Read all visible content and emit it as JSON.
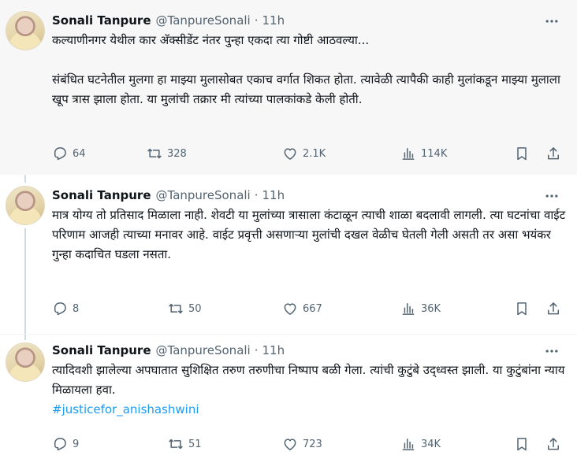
{
  "tweets": [
    {
      "author": {
        "name": "Sonali Tanpure",
        "handle": "@TanpureSonali",
        "time": "11h",
        "avatar": "avatar-photo"
      },
      "paragraphs": [
        "कल्याणीनगर येथील कार अ‍ॅक्सीडेंट नंतर पुन्हा एकदा त्या गोष्टी आठवल्या...",
        "संबंधित घटनेतील मुलगा हा माझ्या मुलासोबत एकाच वर्गात शिकत होता. त्यावेळी त्यापैकी काही मुलांकडून माझ्या मुलाला खूप त्रास झाला होता. या मुलांची तक्रार मी त्यांच्या पालकांकडे केली होती."
      ],
      "stats": {
        "replies": "64",
        "reposts": "328",
        "likes": "2.1K",
        "views": "114K"
      }
    },
    {
      "author": {
        "name": "Sonali Tanpure",
        "handle": "@TanpureSonali",
        "time": "11h",
        "avatar": "avatar-photo"
      },
      "paragraphs": [
        "मात्र योग्य तो प्रतिसाद मिळाला नाही. शेवटी या मुलांच्या त्रासाला कंटाळून त्याची शाळा बदलावी लागली. त्या घटनांचा वाईट परिणाम आजही त्याच्या मनावर आहे. वाईट प्रवृत्ती असणाऱ्या मुलांची दखल वेळीच घेतली गेली असती तर असा भयंकर गुन्हा कदाचित घडला नसता."
      ],
      "stats": {
        "replies": "8",
        "reposts": "50",
        "likes": "667",
        "views": "36K"
      }
    },
    {
      "author": {
        "name": "Sonali Tanpure",
        "handle": "@TanpureSonali",
        "time": "11h",
        "avatar": "avatar-photo"
      },
      "paragraphs": [
        "त्यादिवशी झालेल्या अपघातात सुशिक्षित तरुण तरुणीचा निष्पाप बळी गेला. त्यांची कुटुंबे उद्ध्वस्त झाली. या कुटुंबांना न्याय मिळायला हवा."
      ],
      "hashtag": "#justicefor_anishashwini",
      "stats": {
        "replies": "9",
        "reposts": "51",
        "likes": "723",
        "views": "34K"
      }
    }
  ],
  "colors": {
    "text": "#0f1419",
    "muted": "#536471",
    "link": "#1d9bf0",
    "highlight_bg": "#f7f7f7",
    "thread_line": "#cfd9de"
  },
  "icons": [
    "reply-icon",
    "repost-icon",
    "like-icon",
    "views-icon",
    "bookmark-icon",
    "share-icon",
    "more-icon"
  ]
}
